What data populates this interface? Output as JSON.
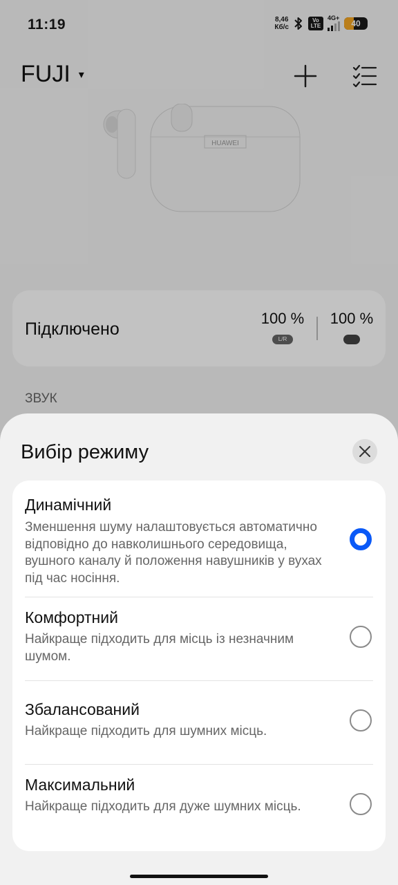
{
  "status_bar": {
    "time": "11:19",
    "net_speed_value": "8,46",
    "net_speed_unit": "Кб/с",
    "volte_top": "Vo",
    "volte_bottom": "LTE",
    "network_type": "4G+",
    "battery_level": "40",
    "battery_fill": 0.4,
    "battery_color": "#f5a623"
  },
  "header": {
    "device_name": "FUJI",
    "caret": "▾"
  },
  "product_image": {
    "brand_text": "HUAWEI"
  },
  "connection_card": {
    "status": "Підключено",
    "earbuds_battery": "100 %",
    "earbuds_tag": "L/R",
    "case_battery": "100 %"
  },
  "sections": {
    "sound_label": "ЗВУК"
  },
  "mode_sheet": {
    "title": "Вибір режиму",
    "options": [
      {
        "title": "Динамічний",
        "description": "Зменшення шуму налаштовується автоматично відповідно до навколишнього середовища, вушного каналу й положення навушників у вухах під час носіння.",
        "selected": true
      },
      {
        "title": "Комфортний",
        "description": "Найкраще підходить для місць із незначним шумом.",
        "selected": false
      },
      {
        "title": "Збалансований",
        "description": "Найкраще підходить для шумних місць.",
        "selected": false
      },
      {
        "title": "Максимальний",
        "description": "Найкраще підходить для дуже шумних місць.",
        "selected": false
      }
    ]
  },
  "colors": {
    "accent": "#0a59f7"
  }
}
